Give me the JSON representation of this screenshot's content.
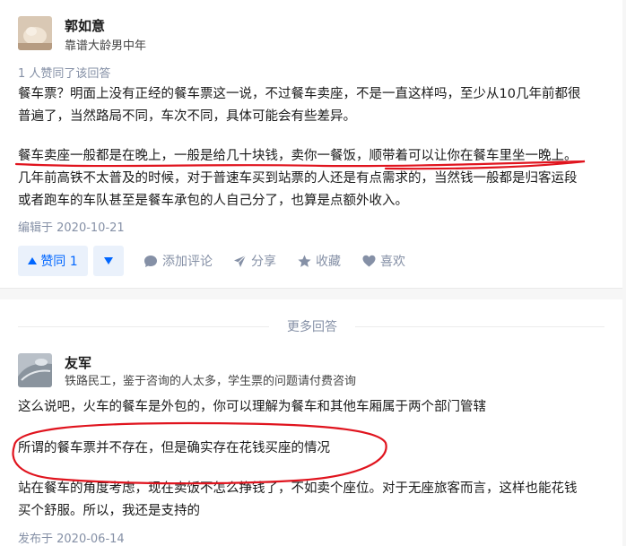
{
  "answer1": {
    "author_name": "郭如意",
    "author_bio": "靠谱大龄男中年",
    "voters_text": "1 人赞同了该回答",
    "paragraph1": [
      "餐车票？明面上没有正经的餐车票这一说，不过餐车卖座，不是一直这样吗，至少从10几年前都很",
      "普遍了，当然路局不同，车次不同，具体可能会有些差异。"
    ],
    "paragraph2": [
      "餐车卖座一般都是在晚上，一般是给几十块钱，卖你一餐饭，顺带着可以让你在餐车里坐一晚上。",
      "几年前高铁不太普及的时候，对于普速车买到站票的人还是有点需求的，当然钱一般都是归客运段",
      "或者跑车的车队甚至是餐车承包的人自己分了，也算是点额外收入。"
    ],
    "edit_date": "编辑于 2020-10-21",
    "actions": {
      "vote_up": "赞同 1",
      "comment": "添加评论",
      "share": "分享",
      "collect": "收藏",
      "like": "喜欢"
    }
  },
  "more_answers_label": "更多回答",
  "answer2": {
    "author_name": "友军",
    "author_bio": "铁路民工，鉴于咨询的人太多，学生票的问题请付费咨询",
    "paragraph1": [
      "这么说吧，火车的餐车是外包的，你可以理解为餐车和其他车厢属于两个部门管辖"
    ],
    "paragraph2": [
      "所谓的餐车票并不存在，但是确实存在花钱买座的情况"
    ],
    "paragraph3": [
      "站在餐车的角度考虑，现在卖饭不怎么挣钱了，不如卖个座位。对于无座旅客而言，这样也能花钱",
      "买个舒服。所以，我还是支持的"
    ],
    "publish_date": "发布于 2020-06-14"
  },
  "colors": {
    "accent": "#0066ff",
    "meta_text": "#8590a6",
    "annotation_red": "#e0141e"
  }
}
